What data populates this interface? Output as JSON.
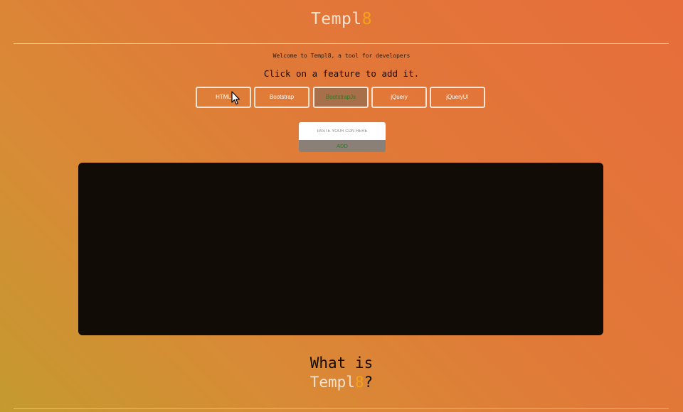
{
  "brand": {
    "name_prefix": "Templ",
    "name_accent": "8"
  },
  "welcome_text": "Welcome to Templ8, a tool for developers",
  "instructions": "Click on a feature to add it.",
  "features": [
    {
      "label": "HTML"
    },
    {
      "label": "Bootstrap"
    },
    {
      "label": "BootstrapJs",
      "selected": true
    },
    {
      "label": "jQuery"
    },
    {
      "label": "jQueryUI"
    }
  ],
  "cdn_form": {
    "placeholder": "PASTE YOUR CDN HERE",
    "value": "",
    "button_label": "ADD"
  },
  "heading": {
    "line1": "What is",
    "brand_prefix": "Templ",
    "brand_accent": "8",
    "suffix": "?"
  },
  "colors": {
    "accent": "#f4a11b",
    "selected_feature_bg": "#a86f4b",
    "selected_feature_text": "#2d7a22",
    "editor_bg": "#120c06"
  }
}
